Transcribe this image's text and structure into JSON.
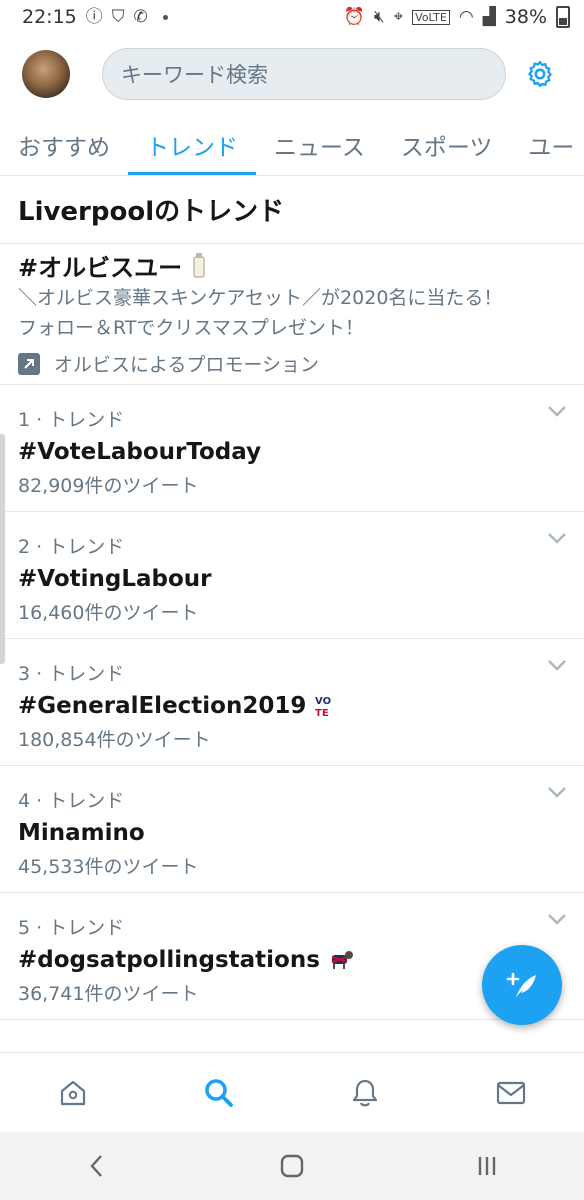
{
  "status_bar": {
    "time": "22:15",
    "battery": "38%"
  },
  "header": {
    "search_placeholder": "キーワード検索"
  },
  "tabs": [
    {
      "label": "おすすめ"
    },
    {
      "label": "トレンド"
    },
    {
      "label": "ニュース"
    },
    {
      "label": "スポーツ"
    },
    {
      "label": "ユー"
    }
  ],
  "section": {
    "title": "Liverpoolのトレンド"
  },
  "promoted": {
    "hashtag": "#オルビスユー",
    "description_line1": "＼オルビス豪華スキンケアセット／が2020名に当たる！",
    "description_line2": "フォロー＆RTでクリスマスプレゼント！",
    "promoted_by": "オルビスによるプロモーション"
  },
  "trends": [
    {
      "meta": "1 · トレンド",
      "name": "#VoteLabourToday",
      "count": "82,909件のツイート"
    },
    {
      "meta": "2 · トレンド",
      "name": "#VotingLabour",
      "count": "16,460件のツイート"
    },
    {
      "meta": "3 · トレンド",
      "name": "#GeneralElection2019",
      "count": "180,854件のツイート"
    },
    {
      "meta": "4 · トレンド",
      "name": "Minamino",
      "count": "45,533件のツイート"
    },
    {
      "meta": "5 · トレンド",
      "name": "#dogsatpollingstations",
      "count": "36,741件のツイート"
    }
  ],
  "colors": {
    "accent": "#1da1f2",
    "secondary_text": "#657786",
    "divider": "#e1e8ed"
  }
}
